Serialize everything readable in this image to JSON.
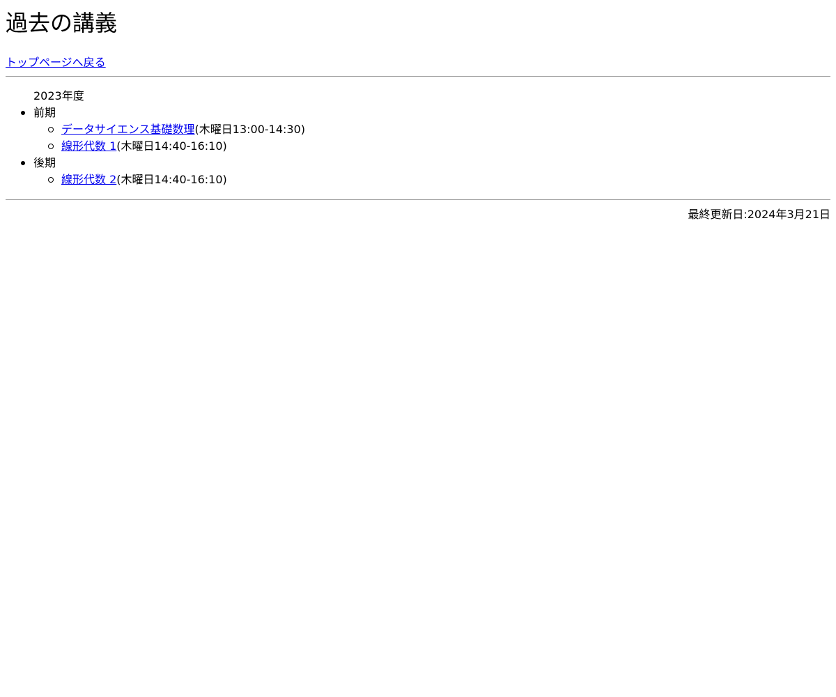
{
  "page": {
    "title": "過去の講義",
    "back_link": "トップページへ戻る"
  },
  "year": {
    "label": "2023年度",
    "terms": [
      {
        "label": "前期",
        "courses": [
          {
            "name": "データサイエンス基礎数理",
            "time": "(木曜日13:00-14:30)"
          },
          {
            "name": "線形代数 1",
            "time": "(木曜日14:40-16:10)"
          }
        ]
      },
      {
        "label": "後期",
        "courses": [
          {
            "name": "線形代数 2",
            "time": "(木曜日14:40-16:10)"
          }
        ]
      }
    ]
  },
  "footer": {
    "last_updated": "最終更新日:2024年3月21日"
  }
}
